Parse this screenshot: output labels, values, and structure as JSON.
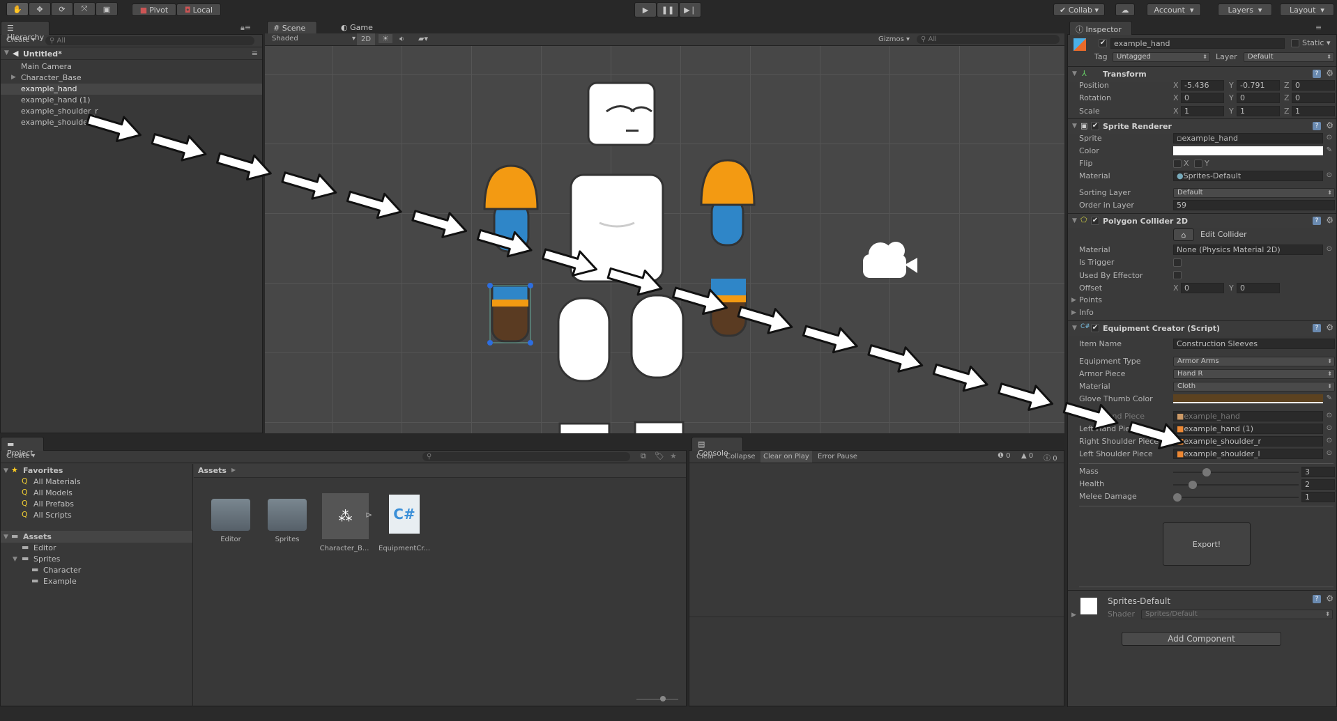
{
  "toolbar": {
    "tools": [
      "hand-tool",
      "move-tool",
      "rotate-tool",
      "scale-tool",
      "rect-tool"
    ],
    "pivot": "Pivot",
    "local": "Local",
    "collab": "Collab",
    "account": "Account",
    "layers": "Layers",
    "layout": "Layout"
  },
  "hierarchy": {
    "title": "Hierarchy",
    "create": "Create",
    "search": "All",
    "scene": "Untitled*",
    "items": [
      "Main Camera",
      "Character_Base",
      "example_hand",
      "example_hand (1)",
      "example_shoulder_r",
      "example_shoulder_l"
    ],
    "selected": "example_hand"
  },
  "scene": {
    "tab": "Scene",
    "game_tab": "Game",
    "shading": "Shaded",
    "mode_2d": "2D",
    "gizmos": "Gizmos",
    "search": "All"
  },
  "inspector": {
    "title": "Inspector",
    "object_name": "example_hand",
    "static": "Static",
    "tag_label": "Tag",
    "tag": "Untagged",
    "layer_label": "Layer",
    "layer": "Default",
    "transform": {
      "title": "Transform",
      "position_label": "Position",
      "rotation_label": "Rotation",
      "scale_label": "Scale",
      "position": [
        "-5.436",
        "-0.791",
        "0"
      ],
      "rotation": [
        "0",
        "0",
        "0"
      ],
      "scale": [
        "1",
        "1",
        "1"
      ],
      "axes": [
        "X",
        "Y",
        "Z"
      ]
    },
    "sprite_renderer": {
      "title": "Sprite Renderer",
      "sprite_label": "Sprite",
      "sprite": "example_hand",
      "color_label": "Color",
      "color": "#ffffff",
      "flip_label": "Flip",
      "flip_x": "X",
      "flip_y": "Y",
      "material_label": "Material",
      "material": "Sprites-Default",
      "sorting_layer_label": "Sorting Layer",
      "sorting_layer": "Default",
      "order_label": "Order in Layer",
      "order": "59"
    },
    "polygon_collider": {
      "title": "Polygon Collider 2D",
      "edit_collider": "Edit Collider",
      "material_label": "Material",
      "material": "None (Physics Material 2D)",
      "is_trigger_label": "Is Trigger",
      "used_by_effector_label": "Used By Effector",
      "offset_label": "Offset",
      "offset": [
        "0",
        "0"
      ],
      "points_label": "Points",
      "info_label": "Info"
    },
    "equipment_creator": {
      "title": "Equipment Creator (Script)",
      "item_name_label": "Item Name",
      "item_name": "Construction Sleeves",
      "equipment_type_label": "Equipment Type",
      "equipment_type": "Armor Arms",
      "armor_piece_label": "Armor Piece",
      "armor_piece": "Hand R",
      "material_label": "Material",
      "material": "Cloth",
      "glove_thumb_color_label": "Glove Thumb Color",
      "glove_thumb_color": "#5c4220",
      "pieces": [
        {
          "label": "Right Hand Piece",
          "value": "example_hand",
          "disabled": true
        },
        {
          "label": "Left Hand Piece",
          "value": "example_hand (1)"
        },
        {
          "label": "Right Shoulder Piece",
          "value": "example_shoulder_r"
        },
        {
          "label": "Left Shoulder Piece",
          "value": "example_shoulder_l"
        }
      ],
      "sliders": [
        {
          "label": "Mass",
          "value": "3",
          "fraction": 0.25
        },
        {
          "label": "Health",
          "value": "2",
          "fraction": 0.13
        },
        {
          "label": "Melee Damage",
          "value": "1",
          "fraction": 0.0
        }
      ],
      "export": "Export!"
    },
    "material_preview": {
      "name": "Sprites-Default",
      "shader_label": "Shader",
      "shader": "Sprites/Default"
    },
    "add_component": "Add Component"
  },
  "project": {
    "title": "Project",
    "create": "Create",
    "favorites": "Favorites",
    "favorite_items": [
      "All Materials",
      "All Models",
      "All Prefabs",
      "All Scripts"
    ],
    "assets": "Assets",
    "asset_tree": [
      "Editor",
      "Sprites",
      "Character",
      "Example"
    ],
    "breadcrumb": "Assets",
    "grid": [
      {
        "name": "Editor",
        "type": "folder"
      },
      {
        "name": "Sprites",
        "type": "folder"
      },
      {
        "name": "Character_B...",
        "type": "prefab"
      },
      {
        "name": "EquipmentCr...",
        "type": "script"
      }
    ]
  },
  "console": {
    "title": "Console",
    "clear": "Clear",
    "collapse": "Collapse",
    "clear_on_play": "Clear on Play",
    "error_pause": "Error Pause",
    "info_count": "0",
    "warning_count": "0",
    "error_count": "0"
  }
}
